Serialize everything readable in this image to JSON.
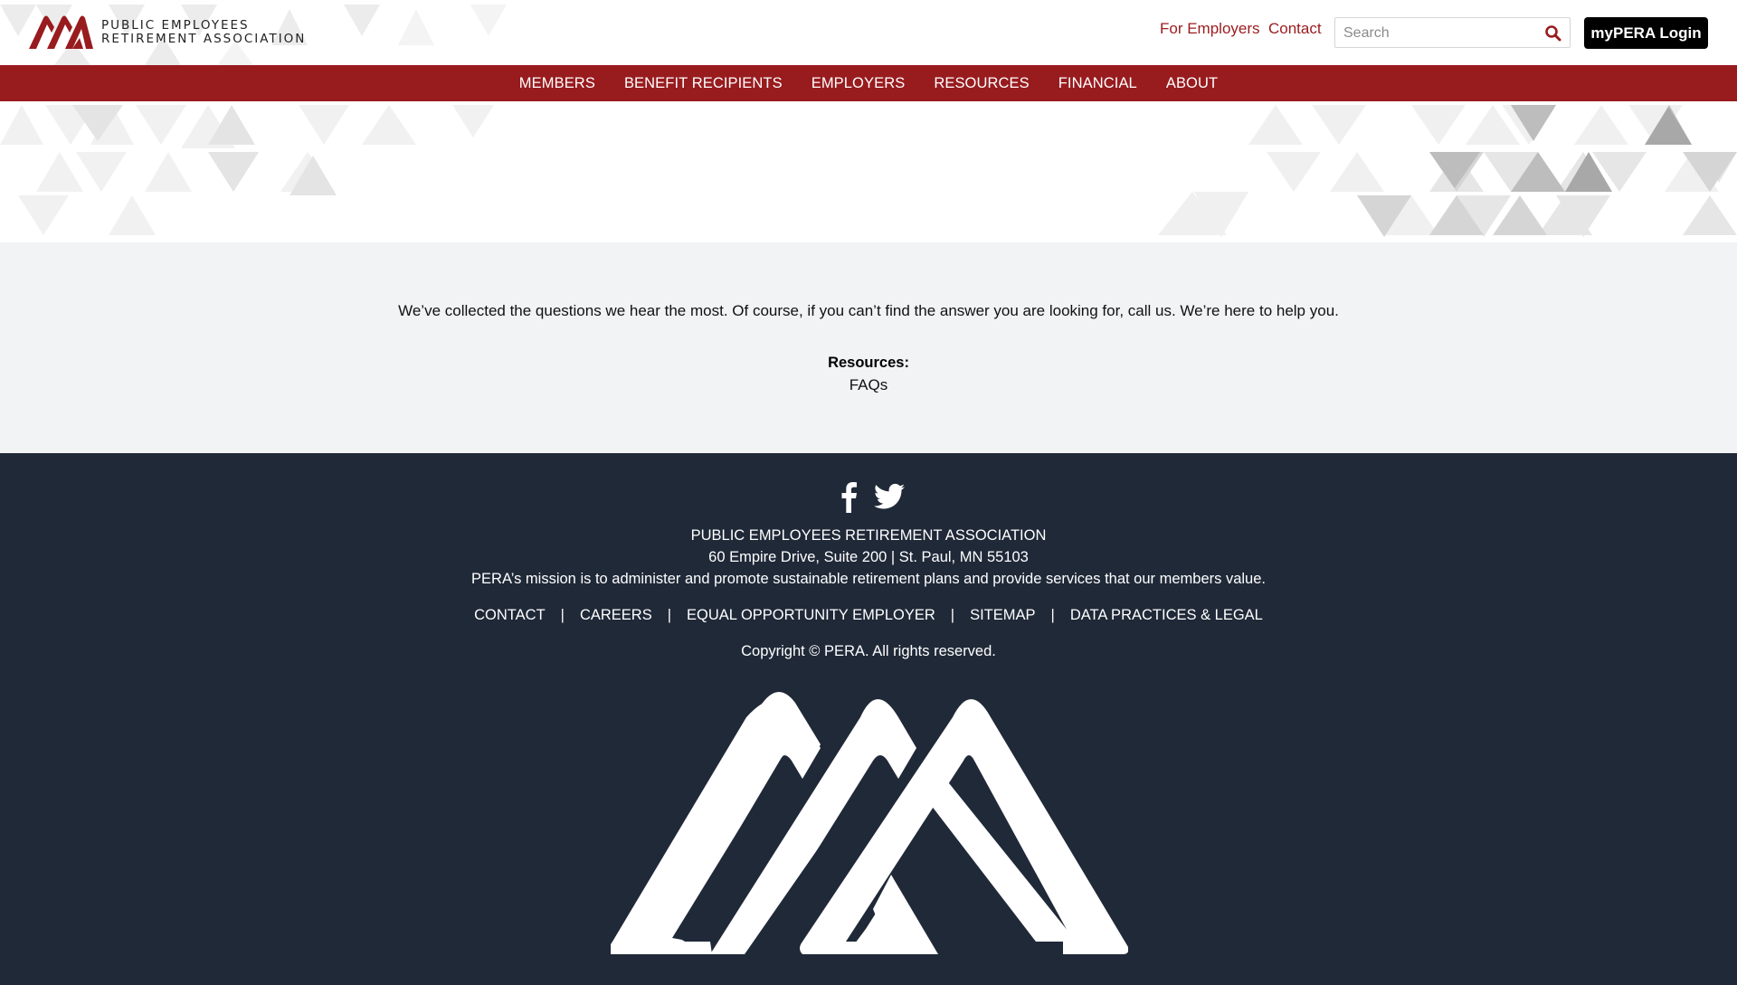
{
  "header": {
    "logo_line1": "PUBLIC EMPLOYEES",
    "logo_line2": "RETIREMENT ASSOCIATION",
    "links": [
      {
        "label": "For Employers"
      },
      {
        "label": "Contact"
      }
    ],
    "search": {
      "placeholder": "Search",
      "value": ""
    },
    "login_label": "myPERA Login"
  },
  "nav": {
    "items": [
      {
        "label": "MEMBERS"
      },
      {
        "label": "BENEFIT RECIPIENTS"
      },
      {
        "label": "EMPLOYERS"
      },
      {
        "label": "RESOURCES"
      },
      {
        "label": "FINANCIAL"
      },
      {
        "label": "ABOUT"
      }
    ]
  },
  "main": {
    "intro": "We’ve collected the questions we hear the most. Of course, if you can’t find the answer you are looking for, call us. We’re here to help you.",
    "resources_label": "Resources:",
    "resources_link": "FAQs"
  },
  "footer": {
    "org_name": "PUBLIC EMPLOYEES RETIREMENT ASSOCIATION",
    "address": "60 Empire Drive, Suite 200 | St. Paul, MN 55103",
    "mission": "PERA’s mission is to administer and promote sustainable retirement plans and provide services that our members value.",
    "links": [
      {
        "label": "CONTACT"
      },
      {
        "label": "CAREERS"
      },
      {
        "label": "EQUAL OPPORTUNITY EMPLOYER"
      },
      {
        "label": "SITEMAP"
      },
      {
        "label": "DATA PRACTICES & LEGAL"
      }
    ],
    "separator": "|",
    "copyright": "Copyright © PERA. All rights reserved."
  },
  "colors": {
    "brand_red": "#981b1e",
    "footer_bg": "#202938",
    "content_bg": "#f2f3f5",
    "login_bg": "#000000"
  },
  "icons": [
    "search-icon",
    "facebook-icon",
    "twitter-icon",
    "pera-logo-icon"
  ]
}
